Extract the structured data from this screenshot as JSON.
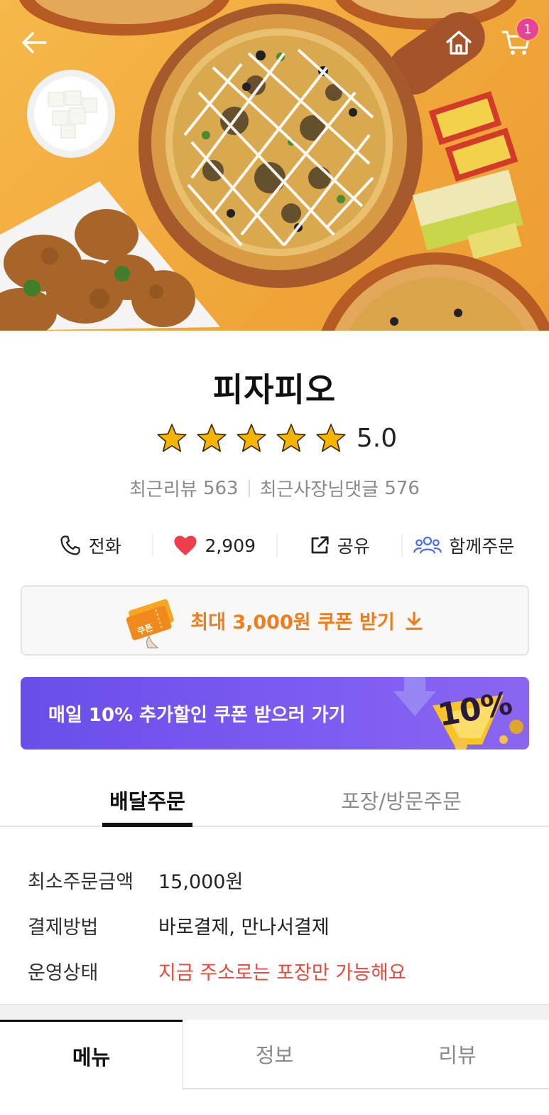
{
  "header": {
    "back_icon": "back-arrow-icon",
    "home_icon": "home-icon",
    "cart_icon": "cart-icon",
    "cart_count": "1"
  },
  "store": {
    "name": "피자피오",
    "rating": "5.0",
    "rating_value": 5.0,
    "stars_total": 5,
    "recent_reviews_label": "최근리뷰",
    "recent_reviews_count": "563",
    "owner_replies_label": "최근사장님댓글",
    "owner_replies_count": "576"
  },
  "actions": {
    "call": "전화",
    "likes": "2,909",
    "share": "공유",
    "group_order": "함께주문"
  },
  "coupon": {
    "label": "최대 3,000원 쿠폰 받기",
    "ticket_text": "쿠폰"
  },
  "promo": {
    "label": "매일 10% 추가할인 쿠폰 받으러 가기",
    "badge": "10%"
  },
  "order_tabs": {
    "delivery": "배달주문",
    "pickup": "포장/방문주문",
    "active": "delivery"
  },
  "order_info": [
    {
      "label": "최소주문금액",
      "value": "15,000원",
      "alert": false
    },
    {
      "label": "결제방법",
      "value": "바로결제, 만나서결제",
      "alert": false
    },
    {
      "label": "운영상태",
      "value": "지금 주소로는 포장만 가능해요",
      "alert": true
    }
  ],
  "bottom_tabs": {
    "menu": "메뉴",
    "info": "정보",
    "review": "리뷰",
    "active": "menu"
  },
  "colors": {
    "star": "#f5b400",
    "heart": "#ee3e4b",
    "coupon_text": "#f07d1b",
    "promo_bg": "#6a4ee8",
    "alert": "#e64a3c",
    "cart_badge": "#e6429a"
  }
}
